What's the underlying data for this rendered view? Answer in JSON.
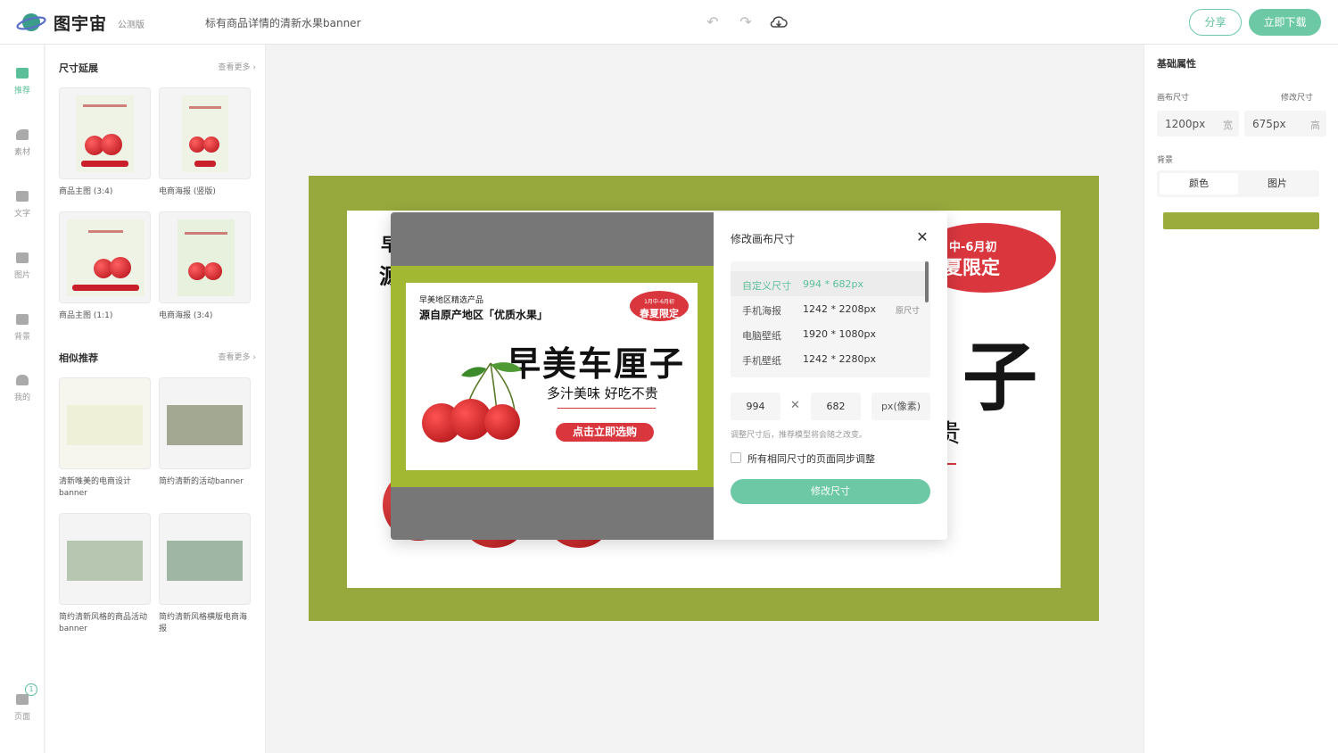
{
  "app": {
    "logo_text": "图宇宙",
    "edition": "公测版",
    "doc_title": "标有商品详情的清新水果banner",
    "share_label": "分享",
    "download_label": "立即下载",
    "icons": [
      "undo-icon",
      "redo-icon",
      "cloud-save-icon"
    ]
  },
  "rail": {
    "items": [
      {
        "label": "推荐",
        "icon": "recommend-icon"
      },
      {
        "label": "素材",
        "icon": "shapes-icon"
      },
      {
        "label": "文字",
        "icon": "text-icon"
      },
      {
        "label": "图片",
        "icon": "image-icon"
      },
      {
        "label": "背景",
        "icon": "background-icon"
      },
      {
        "label": "我的",
        "icon": "user-icon"
      }
    ],
    "pages_label": "页面",
    "pages_count": "1"
  },
  "panel": {
    "size_section": {
      "title": "尺寸延展",
      "more": "查看更多",
      "cards": [
        {
          "label": "商品主图 (3:4)"
        },
        {
          "label": "电商海报 (竖版)"
        },
        {
          "label": "商品主图 (1:1)"
        },
        {
          "label": "电商海报 (3:4)"
        }
      ]
    },
    "similar_section": {
      "title": "相似推荐",
      "more": "查看更多",
      "cards": [
        {
          "label": "清新唯美的电商设计banner"
        },
        {
          "label": "简约清新的活动banner"
        },
        {
          "label": "简约清新风格的商品活动banner"
        },
        {
          "label": "简约清新风格横版电商海报"
        }
      ]
    }
  },
  "props": {
    "title": "基础属性",
    "canvas_size_label": "画布尺寸",
    "modify_size_link": "修改尺寸",
    "width_value": "1200px",
    "width_unit": "宽",
    "height_value": "675px",
    "height_unit": "高",
    "background_label": "背景",
    "bg_tabs": [
      "颜色",
      "图片"
    ],
    "bg_color": "#9bab3c"
  },
  "canvas": {
    "frame_color": "#97a83d",
    "fragments": {
      "c1": "早",
      "c2": "源",
      "c3": "子",
      "c4": "贵",
      "badge_l1": "中-6月初",
      "badge_l2": "夏限定"
    }
  },
  "preview": {
    "green": "#a3b832",
    "line1": "早美地区精选产品",
    "line2": "源自原产地区「优质水果」",
    "badge_top": "1月中-6月初",
    "badge_main": "春夏限定",
    "headline": "早美车厘子",
    "subline": "多汁美味 好吃不贵",
    "cta": "点击立即选购"
  },
  "modal": {
    "title": "修改画布尺寸",
    "presets": [
      {
        "name": "自定义尺寸",
        "size": "994 * 682px",
        "tag": ""
      },
      {
        "name": "手机海报",
        "size": "1242 * 2208px",
        "tag": "原尺寸"
      },
      {
        "name": "电脑壁纸",
        "size": "1920 * 1080px",
        "tag": ""
      },
      {
        "name": "手机壁纸",
        "size": "1242 * 2280px",
        "tag": ""
      }
    ],
    "width": "994",
    "height": "682",
    "unit": "px(像素)",
    "hint": "调整尺寸后，推荐模型将会随之改变。",
    "sync_label": "所有相同尺寸的页面同步调整",
    "submit": "修改尺寸"
  }
}
